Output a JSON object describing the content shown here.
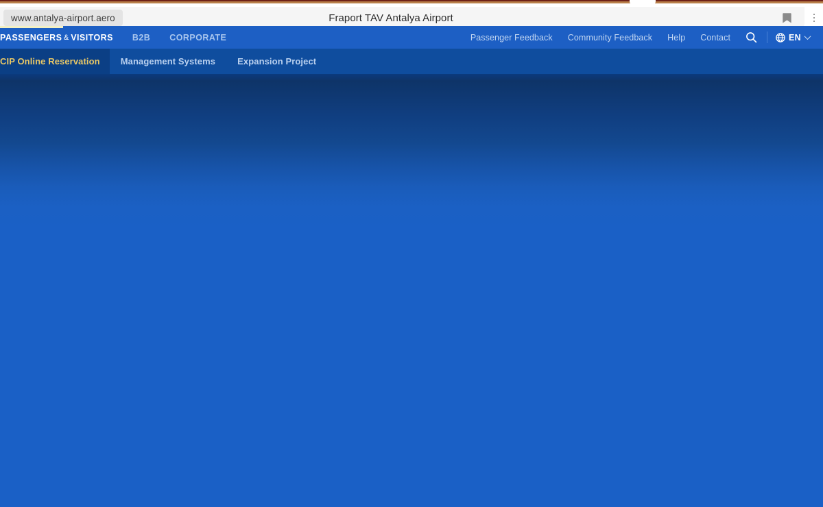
{
  "browser": {
    "url": "www.antalya-airport.aero",
    "page_title": "Fraport TAV Antalya Airport",
    "bookmark_icon": "bookmark-icon",
    "menu_icon": "kebab-menu-icon"
  },
  "site": {
    "audience_nav": [
      {
        "label": "PASSENGERS",
        "separator": "&",
        "label2": "VISITORS",
        "active": true
      },
      {
        "label": "B2B",
        "active": false
      },
      {
        "label": "CORPORATE",
        "active": false
      }
    ],
    "utility_nav": [
      {
        "label": "Passenger Feedback"
      },
      {
        "label": "Community Feedback"
      },
      {
        "label": "Help"
      },
      {
        "label": "Contact"
      }
    ],
    "search_icon": "search-icon",
    "language": {
      "globe_icon": "globe-icon",
      "code": "EN",
      "chevron_icon": "chevron-down-icon"
    },
    "secondary_nav": [
      {
        "label": "CIP Online Reservation",
        "highlighted": true
      },
      {
        "label": "Management Systems",
        "highlighted": false
      },
      {
        "label": "Expansion Project",
        "highlighted": false
      }
    ]
  },
  "colors": {
    "nav_primary_bg": "#1d5fc4",
    "nav_secondary_bg": "#0f4d9e",
    "highlight_bg": "#0b3f85",
    "highlight_text": "#e8c766",
    "hero_top": "#0e3468",
    "hero_bottom": "#1a60c6",
    "progress_underline": "#f3f0c4",
    "chrome_stripe": "#b9804a"
  }
}
